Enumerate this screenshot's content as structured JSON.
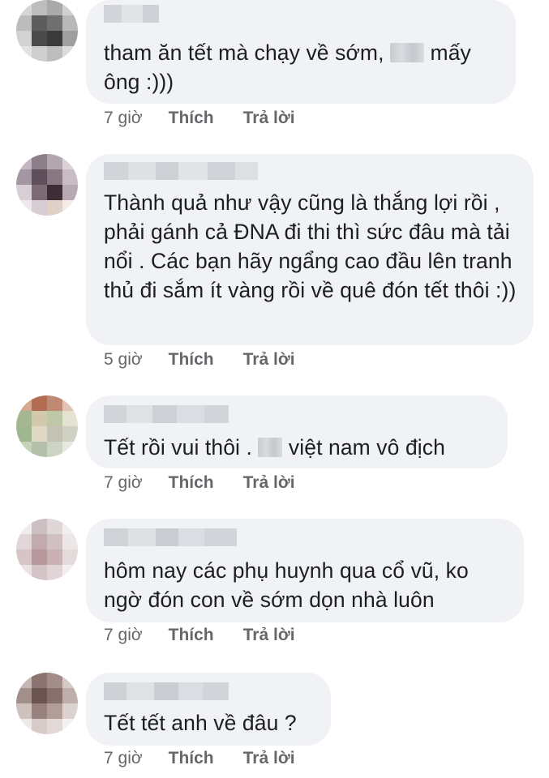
{
  "comments": [
    {
      "text_a": "tham ăn tết mà chạy về sớm,",
      "text_b": "mấy ông :)))",
      "time": "7 giờ",
      "like": "Thích",
      "reply": "Trả lời"
    },
    {
      "text": "Thành quả như vậy cũng là thắng lợi rồi , phải gánh cả ĐNA đi thi thì sức đâu mà tải nổi . Các bạn hãy ngẩng cao đầu lên tranh thủ đi sắm ít vàng rồi về quê đón tết thôi :))",
      "time": "5 giờ",
      "like": "Thích",
      "reply": "Trả lời"
    },
    {
      "text_a": "Tết rồi vui thôi .",
      "text_b": "việt nam vô địch",
      "time": "7 giờ",
      "like": "Thích",
      "reply": "Trả lời"
    },
    {
      "text": "hôm nay các phụ huynh qua cổ vũ, ko ngờ đón con về sớm dọn nhà luôn",
      "time": "7 giờ",
      "like": "Thích",
      "reply": "Trả lời"
    },
    {
      "text": "Tết tết anh về đâu ?",
      "time": "7 giờ",
      "like": "Thích",
      "reply": "Trả lời"
    }
  ],
  "colors": {
    "bubble": "#f1f2f6",
    "text": "#1c1e21",
    "meta": "#65676b"
  }
}
